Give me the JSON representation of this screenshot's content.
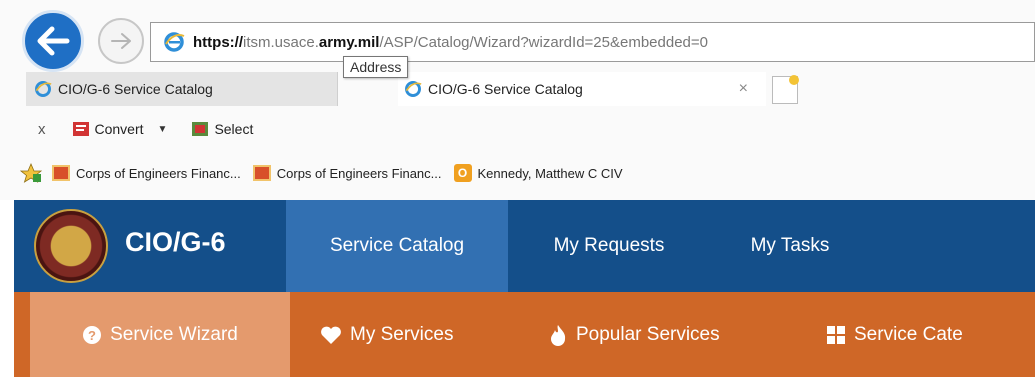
{
  "browser": {
    "address_bar": {
      "scheme": "https://",
      "host_prefix": "itsm.usace.",
      "host_domain": "army.mil",
      "path": "/ASP/Catalog/Wizard?wizardId=25&embedded=0"
    },
    "tooltip": "Address",
    "tabs": [
      {
        "label": "CIO/G-6 Service Catalog"
      },
      {
        "label": "CIO/G-6 Service Catalog",
        "close": "×"
      }
    ],
    "command_bar": {
      "close": "x",
      "convert": "Convert",
      "select": "Select"
    },
    "favorites": [
      {
        "label": "Corps of Engineers Financ..."
      },
      {
        "label": "Corps of Engineers Financ..."
      },
      {
        "label": "Kennedy, Matthew C CIV"
      }
    ]
  },
  "site": {
    "brand": "CIO/G-6",
    "nav": [
      {
        "label": "Service Catalog"
      },
      {
        "label": "My Requests"
      },
      {
        "label": "My Tasks"
      }
    ],
    "subnav": [
      {
        "label": "Service Wizard"
      },
      {
        "label": "My Services"
      },
      {
        "label": "Popular Services"
      },
      {
        "label": "Service Cate"
      }
    ]
  },
  "colors": {
    "nav_bg": "#144f8a",
    "nav_active": "#3270b2",
    "subnav_bg": "#cf6727",
    "subnav_active": "#e49a6d"
  }
}
